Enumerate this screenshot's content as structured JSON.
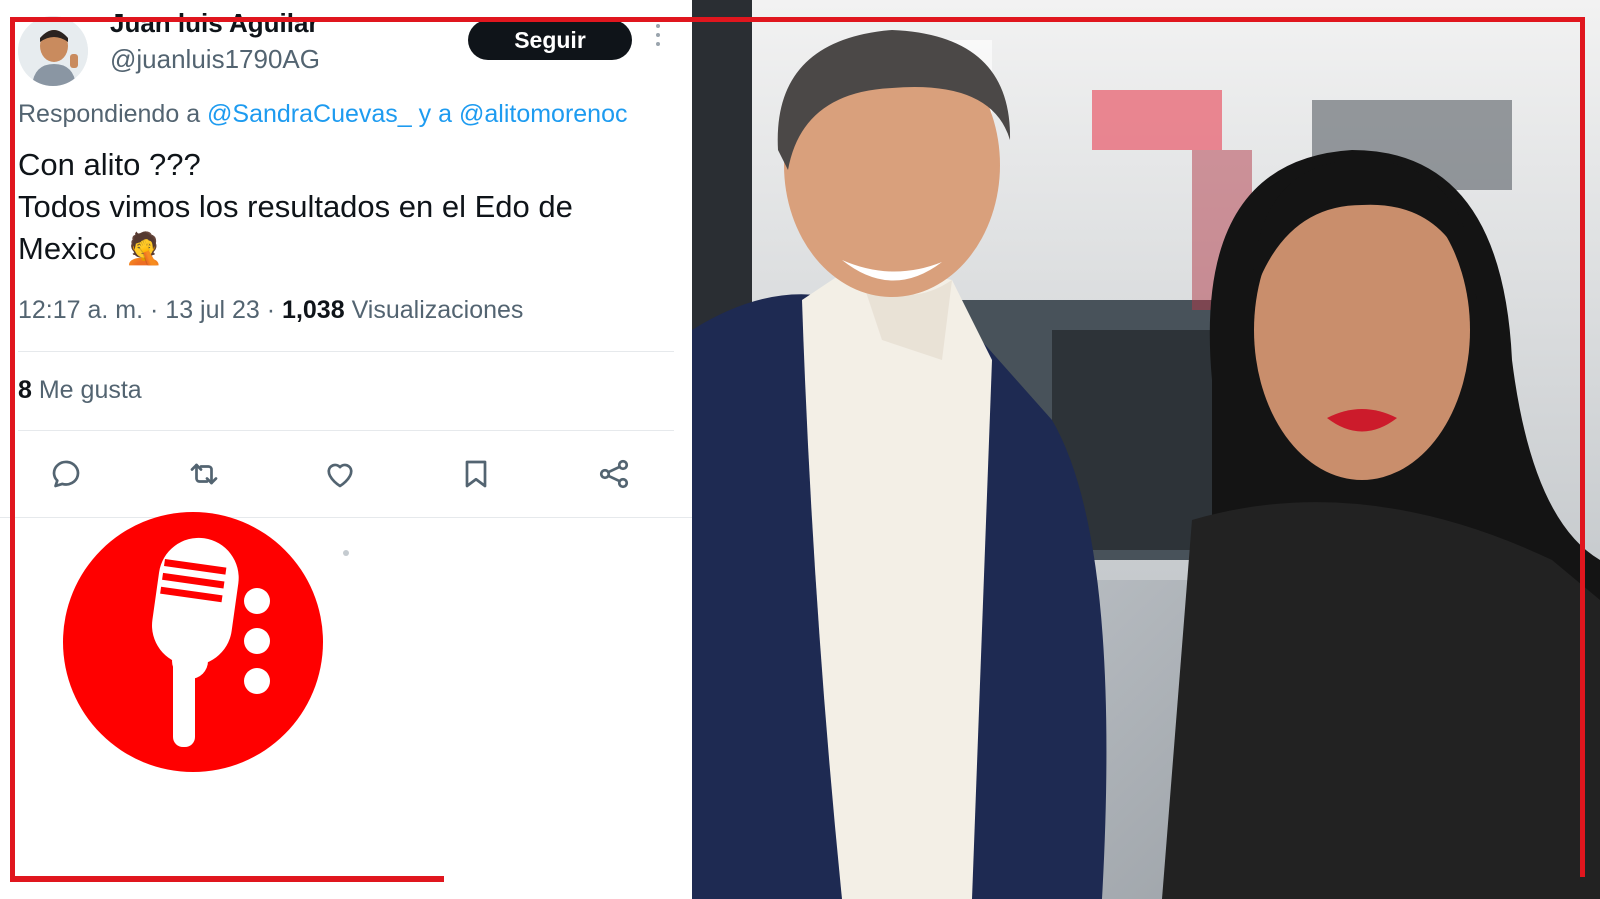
{
  "tweet": {
    "author_name": "Juan luis Aguilar",
    "author_handle": "@juanluis1790AG",
    "follow_label": "Seguir",
    "reply_prefix": "Respondiendo a",
    "reply_mention_1": "@SandraCuevas_",
    "reply_joiner": "y a",
    "reply_mention_2": "@alitomorenoc",
    "text_line_1": "Con alito ???",
    "text_line_2": "Todos vimos los resultados en el Edo de",
    "text_line_3": "Mexico 🤦",
    "time": "12:17 a. m. · 13 jul 23 ·",
    "views_count": "1,038",
    "views_label": "Visualizaciones",
    "likes_count": "8",
    "likes_label": "Me gusta"
  },
  "actions": [
    "reply-icon",
    "retweet-icon",
    "like-icon",
    "bookmark-icon",
    "share-icon"
  ],
  "logo": {
    "icon": "microphone-icon",
    "color": "#ff0000"
  },
  "colors": {
    "frame": "#e0161e",
    "link": "#1d9bf0",
    "text": "#0f1419",
    "muted": "#536471"
  }
}
